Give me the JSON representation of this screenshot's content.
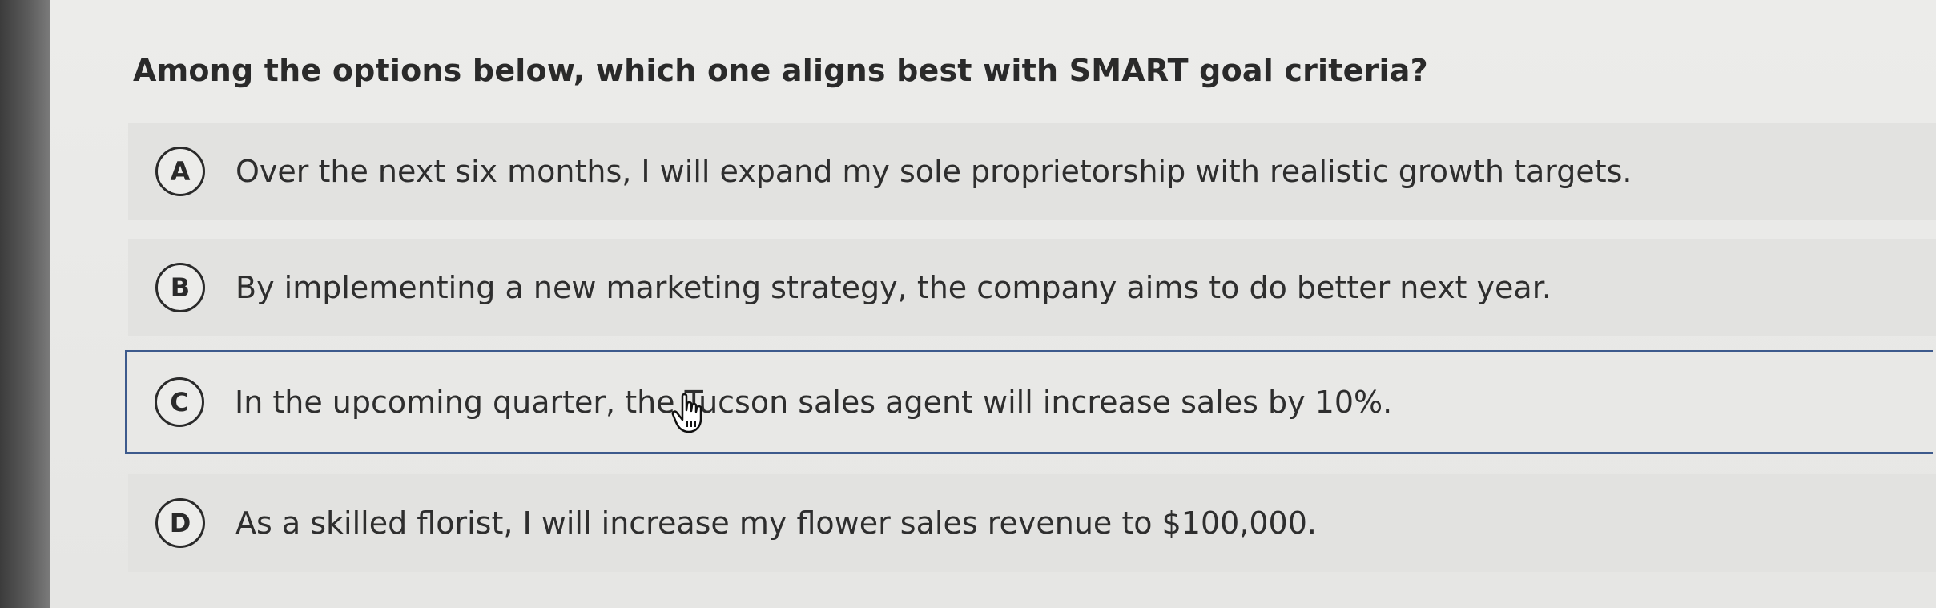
{
  "question": {
    "text": "Among the options below, which one aligns best with SMART goal criteria?"
  },
  "options": [
    {
      "letter": "A",
      "text": "Over the next six months, I will expand my sole proprietorship with realistic growth targets.",
      "selected": false
    },
    {
      "letter": "B",
      "text": "By implementing a new marketing strategy, the company aims to do better next year.",
      "selected": false
    },
    {
      "letter": "C",
      "text": "In the upcoming quarter, the Tucson sales agent will increase sales by 10%.",
      "selected": true
    },
    {
      "letter": "D",
      "text": "As a skilled florist, I will increase my flower sales revenue to $100,000.",
      "selected": false
    }
  ],
  "colors": {
    "selected_border": "#3d5a8c",
    "option_background": "#e2e2e0"
  },
  "cursor": {
    "icon": "hand-pointer-icon"
  }
}
